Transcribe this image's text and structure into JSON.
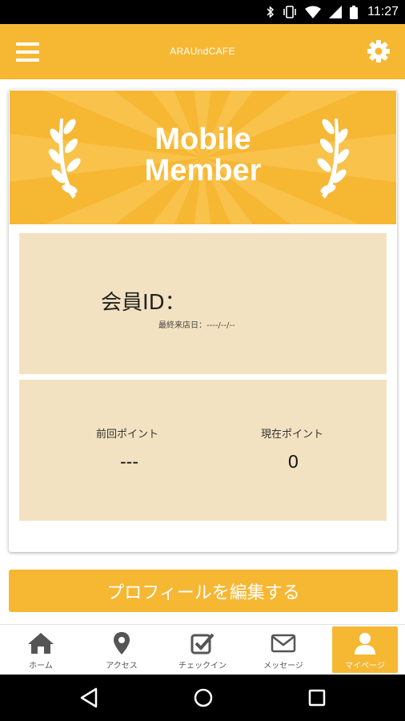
{
  "status_bar": {
    "time": "11:27",
    "icons": [
      "bluetooth-icon",
      "vibrate-icon",
      "wifi-icon",
      "signal-icon",
      "battery-icon"
    ]
  },
  "app_bar": {
    "title": "ARAUndCAFE",
    "menu_icon": "hamburger-menu-icon",
    "settings_icon": "gear-icon"
  },
  "card": {
    "header_title_line1": "Mobile",
    "header_title_line2": "Member",
    "member_id_label": "会員ID：",
    "last_visit": "最終来店日：----/--/--",
    "points": {
      "previous_label": "前回ポイント",
      "previous_value": "---",
      "current_label": "現在ポイント",
      "current_value": "0"
    }
  },
  "edit_profile_button": "プロフィールを編集する",
  "bottom_nav": {
    "items": [
      {
        "label": "ホーム",
        "icon": "home-icon",
        "active": false
      },
      {
        "label": "アクセス",
        "icon": "map-pin-icon",
        "active": false
      },
      {
        "label": "チェックイン",
        "icon": "checkbox-icon",
        "active": false
      },
      {
        "label": "メッセージ",
        "icon": "envelope-icon",
        "active": false
      },
      {
        "label": "マイページ",
        "icon": "user-icon",
        "active": true
      }
    ]
  },
  "system_nav": {
    "buttons": [
      "back-icon",
      "home-circle-icon",
      "recents-icon"
    ]
  },
  "colors": {
    "accent": "#f6b733",
    "panel": "#f3e2c1",
    "status_bar": "#000000"
  }
}
